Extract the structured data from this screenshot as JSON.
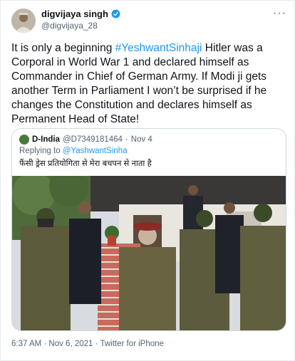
{
  "author": {
    "name": "digvijaya singh",
    "handle": "@digvijaya_28"
  },
  "tweet": {
    "text_before": "It is only a beginning ",
    "hashtag": "#YeshwantSinhaji",
    "text_after": " Hitler was a Corporal in World War 1 and declared himself as Commander in Chief of German Army. If Modi ji gets another Term in Parliament I won’t be surprised if he changes the Constitution and declares himself as Permanent Head of State!"
  },
  "quoted": {
    "name": "D-India",
    "handle": "@D7349181464",
    "date": "Nov 4",
    "reply_prefix": "Replying to ",
    "reply_to": "@YashwantSinha",
    "text": "फैंसी ड्रेस प्रतियोगिता से मेरा बचपन से नाता है"
  },
  "footer": {
    "timestamp": "6:37 AM · Nov 6, 2021 · Twitter for iPhone"
  },
  "colors": {
    "link": "#1d9bf0",
    "muted": "#536471",
    "text": "#0f1419",
    "border": "#cfd9de"
  },
  "icons": [
    "verified-badge-icon",
    "more-options-icon"
  ]
}
